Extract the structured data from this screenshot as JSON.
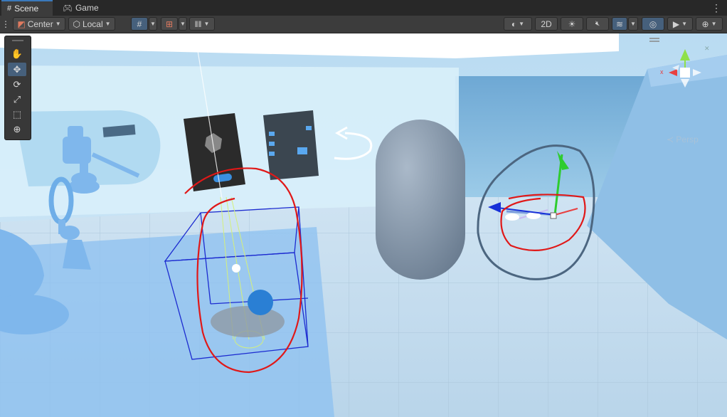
{
  "tabs": [
    {
      "label": "Scene",
      "icon": "grid-icon",
      "active": true
    },
    {
      "label": "Game",
      "icon": "gamepad-icon",
      "active": false
    }
  ],
  "toolbar": {
    "pivot_mode": "Center",
    "pivot_rotation": "Local",
    "mode_2d": "2D"
  },
  "tools": [
    {
      "name": "hand-tool",
      "icon": "hand-icon",
      "glyph": "✋"
    },
    {
      "name": "move-tool",
      "icon": "move-icon",
      "glyph": "✥"
    },
    {
      "name": "rotate-tool",
      "icon": "rotate-icon",
      "glyph": "⟳"
    },
    {
      "name": "scale-tool",
      "icon": "scale-icon",
      "glyph": "⤢"
    },
    {
      "name": "rect-tool",
      "icon": "rect-icon",
      "glyph": "⬚"
    },
    {
      "name": "transform-tool",
      "icon": "transform-icon",
      "glyph": "⊕"
    }
  ],
  "gizmo": {
    "projection_label": "Persp"
  },
  "colors": {
    "accent": "#3a79bb",
    "selected_tool": "#46607c",
    "annotation": "#e01818",
    "bounds": "#1c2bd0"
  }
}
